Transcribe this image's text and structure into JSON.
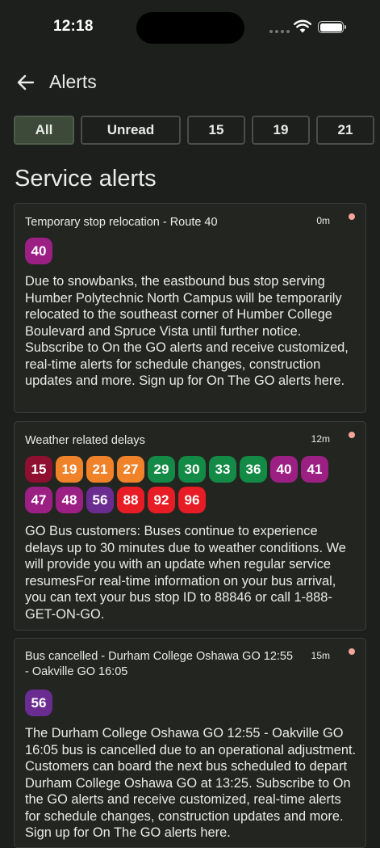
{
  "status_bar": {
    "time": "12:18"
  },
  "header": {
    "title": "Alerts"
  },
  "filters": [
    {
      "label": "All",
      "active": true
    },
    {
      "label": "Unread",
      "active": false
    },
    {
      "label": "15",
      "active": false
    },
    {
      "label": "19",
      "active": false
    },
    {
      "label": "21",
      "active": false
    }
  ],
  "section_title": "Service alerts",
  "alerts": [
    {
      "title": "Temporary stop relocation - Route 40",
      "time": "0m",
      "unread": true,
      "routes": [
        {
          "label": "40",
          "color": "#9c1f84"
        }
      ],
      "body": "Due to snowbanks, the eastbound bus stop serving Humber Polytechnic North Campus will be temporarily relocated to the southeast corner of Humber College Boulevard and Spruce Vista until further notice. Subscribe to On the GO alerts and receive customized, real-time alerts for schedule changes, construction updates and more. Sign up for On The GO alerts here."
    },
    {
      "title": "Weather related delays",
      "time": "12m",
      "unread": true,
      "routes": [
        {
          "label": "15",
          "color": "#8e0f2f"
        },
        {
          "label": "19",
          "color": "#f0822a"
        },
        {
          "label": "21",
          "color": "#f0822a"
        },
        {
          "label": "27",
          "color": "#f0822a"
        },
        {
          "label": "29",
          "color": "#138a45"
        },
        {
          "label": "30",
          "color": "#138a45"
        },
        {
          "label": "33",
          "color": "#138a45"
        },
        {
          "label": "36",
          "color": "#138a45"
        },
        {
          "label": "40",
          "color": "#9c1f84"
        },
        {
          "label": "41",
          "color": "#9c1f84"
        },
        {
          "label": "47",
          "color": "#9c1f84"
        },
        {
          "label": "48",
          "color": "#9c1f84"
        },
        {
          "label": "56",
          "color": "#6a2c91"
        },
        {
          "label": "88",
          "color": "#e81c24"
        },
        {
          "label": "92",
          "color": "#e81c24"
        },
        {
          "label": "96",
          "color": "#e81c24"
        }
      ],
      "body": "GO Bus customers: Buses continue to experience delays up to 30 minutes due to weather conditions. We will provide you with an update when regular service resumesFor real-time information on your bus arrival, you can text your bus stop ID to 88846 or call 1-888-GET-ON-GO."
    },
    {
      "title": "Bus cancelled - Durham College Oshawa GO 12:55 - Oakville GO 16:05",
      "time": "15m",
      "unread": true,
      "routes": [
        {
          "label": "56",
          "color": "#6a2c91"
        }
      ],
      "body": "The Durham College Oshawa GO 12:55 - Oakville GO 16:05 bus is cancelled due to an operational adjustment. Customers can board the next bus scheduled to depart Durham College Oshawa GO at 13:25. Subscribe to On the GO alerts and receive customized, real-time alerts for schedule changes, construction updates and more. Sign up for On The GO alerts here."
    }
  ]
}
